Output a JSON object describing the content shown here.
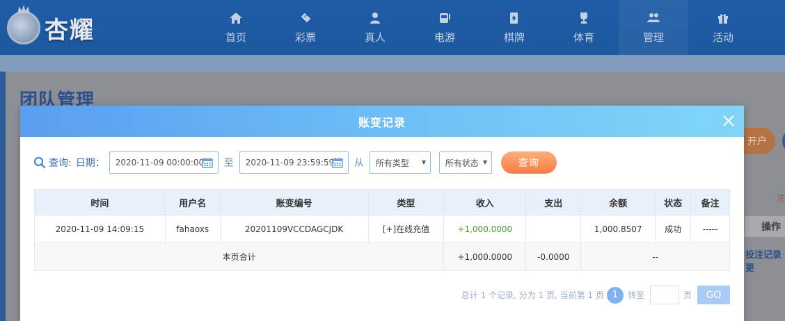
{
  "header": {
    "logo_text": "杏耀",
    "nav": [
      {
        "label": "首页",
        "icon": "home-icon"
      },
      {
        "label": "彩票",
        "icon": "ticket-icon"
      },
      {
        "label": "真人",
        "icon": "dealer-icon"
      },
      {
        "label": "电游",
        "icon": "slot-machine-icon"
      },
      {
        "label": "棋牌",
        "icon": "cards-icon"
      },
      {
        "label": "体育",
        "icon": "trophy-icon"
      },
      {
        "label": "管理",
        "icon": "users-icon"
      },
      {
        "label": "活动",
        "icon": "gift-icon"
      }
    ]
  },
  "background": {
    "page_title": "团队管理",
    "button_fragment": "开户",
    "note_fragment": "注",
    "column_fragment": "操作",
    "link_fragment": "投注记录 更"
  },
  "modal": {
    "title": "账变记录",
    "filter": {
      "query_label": "查询:",
      "date_label": "日期：",
      "start_date": "2020-11-09 00:00:00",
      "to_label": "至",
      "end_date": "2020-11-09 23:59:59",
      "from_label": "从",
      "type_select": "所有类型",
      "status_select": "所有状态",
      "query_button": "查询"
    },
    "table": {
      "headers": [
        "时间",
        "用户名",
        "账变编号",
        "类型",
        "收入",
        "支出",
        "余额",
        "状态",
        "备注"
      ],
      "rows": [
        {
          "time": "2020-11-09 14:09:15",
          "username": "fahaoxs",
          "id": "20201109VCCDAGCJDK",
          "type": "[+]在线充值",
          "income": "+1,000.0000",
          "expense": "",
          "balance": "1,000.8507",
          "status": "成功",
          "remark": "-----"
        }
      ],
      "totals": {
        "label": "本页合计",
        "income": "+1,000.0000",
        "expense": "-0.0000",
        "rest": "--"
      }
    },
    "pagination": {
      "summary": "总计 1 个记录, 分为 1 页, 当前第 1 页",
      "current_page": "1",
      "goto_label": "转至",
      "page_label": "页",
      "go_button": "GO"
    }
  },
  "colors": {
    "header_bg": "#1e5ca5",
    "modal_header_start": "#5a9ef0",
    "modal_header_end": "#7fd6f8",
    "query_button": "#f67b45",
    "income_text": "#4a9a2e"
  }
}
